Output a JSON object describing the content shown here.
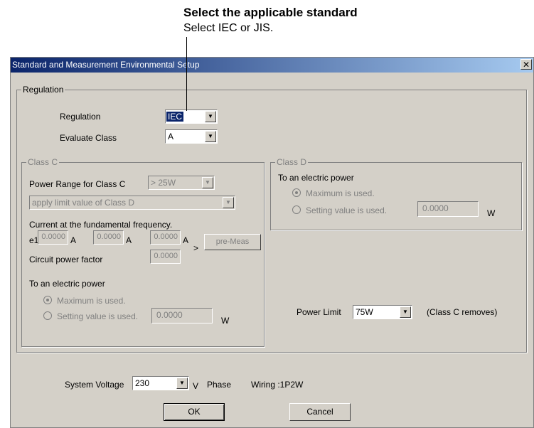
{
  "callout": {
    "title": "Select the applicable standard",
    "subtitle": "Select IEC or JIS."
  },
  "dialog": {
    "title": "Standard and Measurement Environmental Setup",
    "close_glyph": "✕",
    "regulation_group": {
      "legend": "Regulation",
      "regulation_label": "Regulation",
      "regulation_value": "IEC",
      "evaluate_class_label": "Evaluate Class",
      "evaluate_class_value": "A"
    },
    "class_c": {
      "legend": "Class C",
      "power_range_label": "Power Range for Class C",
      "power_range_value": "> 25W",
      "limit_select_value": "apply limit value of Class D",
      "fundamental_label": "Current at the fundamental frequency.",
      "e1_label": "e1",
      "current_values": [
        "0.0000",
        "0.0000",
        "0.0000"
      ],
      "unit_a": "A",
      "circuit_pf_label": "Circuit power factor",
      "circuit_pf_value": "0.0000",
      "gt_sign": ">",
      "pre_meas_label": "pre-Meas",
      "electric_power_label": "To an electric power",
      "maximum_label": "Maximum is used.",
      "setting_label": "Setting value is used.",
      "setting_value": "0.0000",
      "unit_w": "W"
    },
    "class_d": {
      "legend": "Class D",
      "electric_power_label": "To an electric power",
      "maximum_label": "Maximum is used.",
      "setting_label": "Setting value is used.",
      "setting_value": "0.0000",
      "unit_w": "W"
    },
    "power_limit": {
      "label": "Power Limit",
      "value": "75W",
      "note": "(Class C removes)"
    },
    "system": {
      "voltage_label": "System Voltage",
      "voltage_value": "230",
      "voltage_unit": "V",
      "phase_label": "Phase",
      "wiring_label": "Wiring :1P2W"
    },
    "buttons": {
      "ok": "OK",
      "cancel": "Cancel"
    }
  }
}
